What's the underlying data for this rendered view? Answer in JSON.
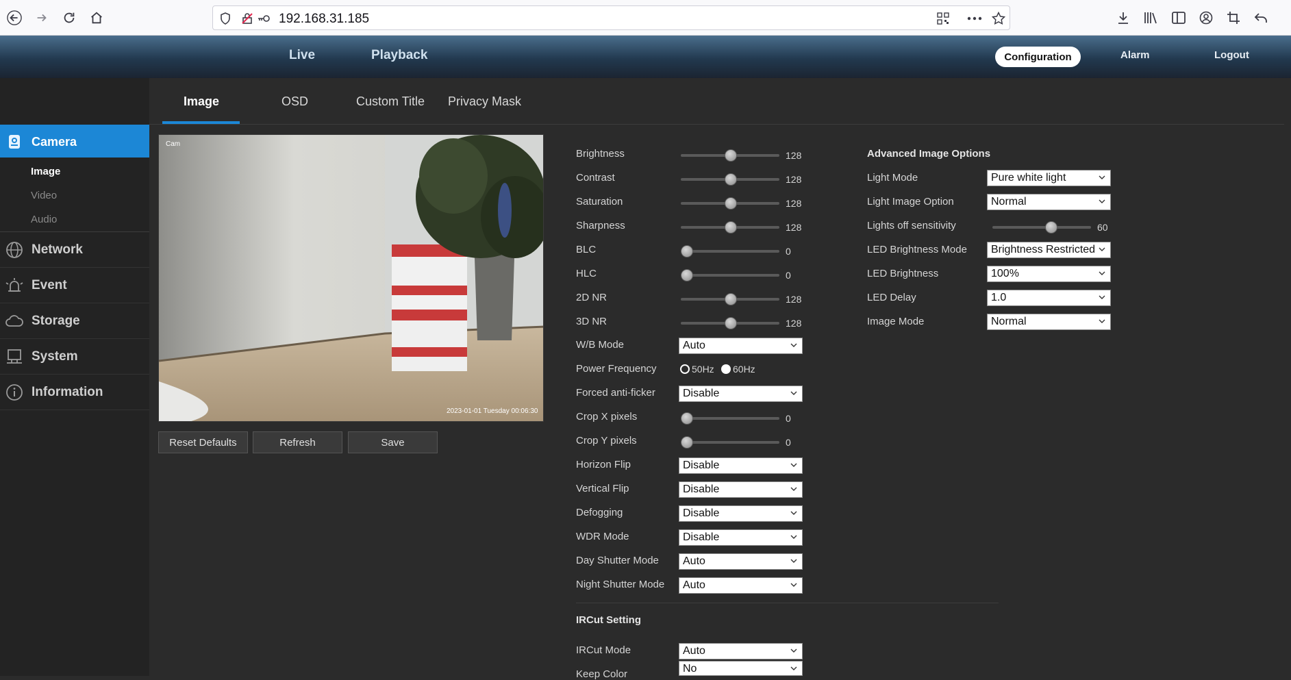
{
  "browser": {
    "url": "192.168.31.185"
  },
  "header": {
    "nav": [
      "Live",
      "Playback"
    ],
    "right": {
      "configuration": "Configuration",
      "alarm": "Alarm",
      "logout": "Logout"
    }
  },
  "sidebar": {
    "camera": "Camera",
    "camera_subs": [
      "Image",
      "Video",
      "Audio"
    ],
    "sections": [
      "Network",
      "Event",
      "Storage",
      "System",
      "Information"
    ]
  },
  "tabs": [
    "Image",
    "OSD",
    "Custom Title",
    "Privacy Mask"
  ],
  "preview": {
    "overlay_top": "Cam",
    "overlay_bottom": "2023-01-01 Tuesday 00:06:30"
  },
  "buttons": {
    "reset": "Reset Defaults",
    "refresh": "Refresh",
    "save": "Save"
  },
  "sliders": [
    {
      "label": "Brightness",
      "value": "128",
      "fraction": 0.5
    },
    {
      "label": "Contrast",
      "value": "128",
      "fraction": 0.5
    },
    {
      "label": "Saturation",
      "value": "128",
      "fraction": 0.5
    },
    {
      "label": "Sharpness",
      "value": "128",
      "fraction": 0.5
    },
    {
      "label": "BLC",
      "value": "0",
      "fraction": 0.0
    },
    {
      "label": "HLC",
      "value": "0",
      "fraction": 0.0
    },
    {
      "label": "2D NR",
      "value": "128",
      "fraction": 0.5
    },
    {
      "label": "3D NR",
      "value": "128",
      "fraction": 0.5
    }
  ],
  "wb_mode": {
    "label": "W/B Mode",
    "value": "Auto"
  },
  "power_frequency": {
    "label": "Power Frequency",
    "opt1": "50Hz",
    "opt2": "60Hz",
    "selected": "60Hz"
  },
  "forced_antiflicker": {
    "label": "Forced anti-ficker",
    "value": "Disable"
  },
  "crop_x": {
    "label": "Crop X pixels",
    "value": "0",
    "fraction": 0.0
  },
  "crop_y": {
    "label": "Crop Y pixels",
    "value": "0",
    "fraction": 0.0
  },
  "selects_lower": [
    {
      "label": "Horizon Flip",
      "value": "Disable"
    },
    {
      "label": "Vertical Flip",
      "value": "Disable"
    },
    {
      "label": "Defogging",
      "value": "Disable"
    },
    {
      "label": "WDR Mode",
      "value": "Disable"
    },
    {
      "label": "Day Shutter Mode",
      "value": "Auto"
    },
    {
      "label": "Night Shutter Mode",
      "value": "Auto"
    }
  ],
  "ircut": {
    "title": "IRCut Setting",
    "mode": {
      "label": "IRCut Mode",
      "value": "Auto"
    },
    "keep_color": {
      "label": "Keep Color",
      "value": "No"
    }
  },
  "advanced": {
    "title": "Advanced Image Options",
    "light_mode": {
      "label": "Light Mode",
      "value": "Pure white light"
    },
    "light_image_option": {
      "label": "Light Image Option",
      "value": "Normal"
    },
    "lights_off_sensitivity": {
      "label": "Lights off sensitivity",
      "value": "60",
      "fraction": 0.6
    },
    "led_brightness_mode": {
      "label": "LED Brightness Mode",
      "value": "Brightness Restricted"
    },
    "led_brightness": {
      "label": "LED Brightness",
      "value": "100%"
    },
    "led_delay": {
      "label": "LED Delay",
      "value": "1.0"
    },
    "image_mode": {
      "label": "Image Mode",
      "value": "Normal"
    }
  },
  "colors": {
    "accent": "#1c87d6",
    "background": "#2b2b2b",
    "sidebar": "#232323"
  }
}
